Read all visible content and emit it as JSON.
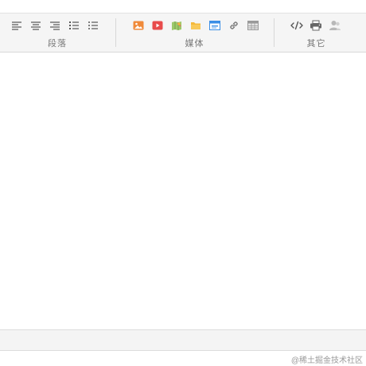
{
  "toolbar": {
    "groups": [
      {
        "label": "段落",
        "icons": [
          "align-left-icon",
          "align-center-icon",
          "align-right-icon",
          "ordered-list-icon",
          "unordered-list-icon"
        ]
      },
      {
        "label": "媒体",
        "icons": [
          "image-icon",
          "video-icon",
          "map-icon",
          "folder-icon",
          "web-embed-icon",
          "link-icon",
          "table-icon"
        ]
      },
      {
        "label": "其它",
        "icons": [
          "code-icon",
          "print-icon",
          "user-icon"
        ]
      }
    ]
  },
  "colors": {
    "image": "#f08a3a",
    "video": "#e84b4b",
    "folder": "#f5b93a",
    "web": "#3a8ee6",
    "icon_gray": "#555555"
  },
  "watermark": "@稀土掘金技术社区"
}
